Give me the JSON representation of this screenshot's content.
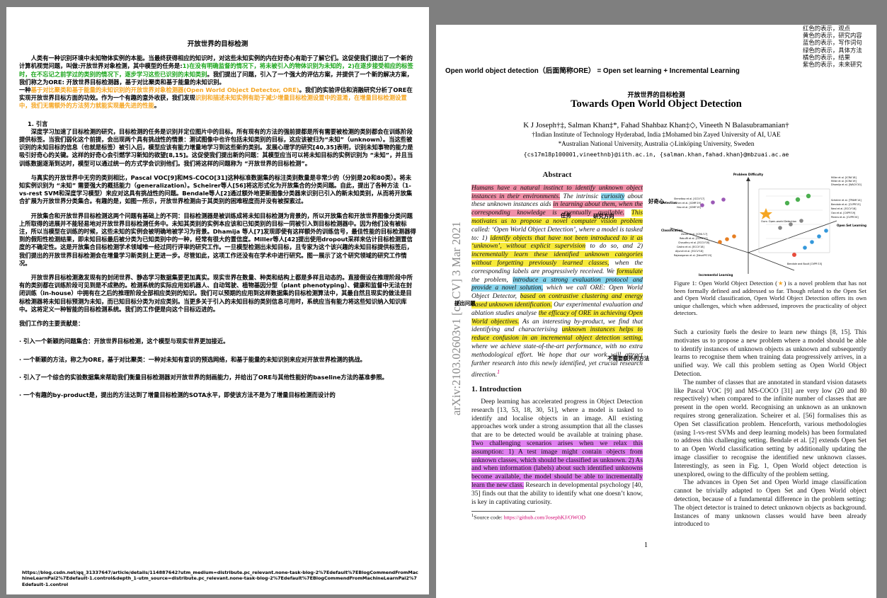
{
  "left_page": {
    "title": "开放世界的目标检测",
    "p1_a": "人类有一种识别环境中未知物体实例的本能。当最终获得相应的知识时，对这些未知实例的内在好奇心有助于了解它们。这促使我们提出了一个新的计算机视觉问题，叫做:开放世界对象检测，其中模型的任务是:",
    "p1_green": "1)在没有明确监督的情况下，将未被引入的物体识别为未知的，2)在逐步接受相应的标签时，在不忘记之前学过的类别的情况下，逐步学习这些已识别的未知类别",
    "p1_b": "。我们提出了问题，引入了一个强大的评估方案，并提供了一个新的解决方案，我们称之为ORE: 开放世界目标检测器，基于对比聚类和基于能量的未知识别。",
    "p1_c": "一种",
    "p1_orange": "基于对比聚类和基于能量的未知识别的开放世界对象检测器(Open World Object Detector, ORE)",
    "p1_d": "。我们的实验评估和消融研究分析了ORE在实现开放世界目标方面的功效。作为一个有趣的意外收获，我们发现",
    "p1_orange2": "识别和描述未知实例有助于减少增量目标检测设置中的混淆，在增量目标检测设置中，我们无需额外的方法努力就能实现最先进的性能",
    "p1_e": "。",
    "sec1": "1. 引言",
    "p2": "深度学习加速了目标检测的研究，目标检测的任务是识别并定位图片中的目标。所有现有的方法的强前提都是所有需要被检测的类别都会在训练阶段提供标签。当我们弱化这个前提，会出现两个具有挑战性的情景：测试图像中也许包括未知类别的目标，这应该被归为“未知”（unknown）。当这些被识别的未知目标的信息（也就是标签）被引入后，模型应该有能力增量地学习到这些新的类别。发展心理学的研究[40,35]表明，识别未知事物的能力是吸引好奇心的关键。这样的好奇心会引燃学习新知的欲望[8,15]。这促使我们提出新的问题：其模型应当可以将未知目标的实例识别为 “未知”，并且当训练数据逐渐到达时，模型可以通过统一的方式学会识别他们。我们将这样的问题称为 “开放世界的目标检测”。",
    "p3": "与真实的开放世界中无穷的类别相比，Pascal VOC[9]和MS-COCO[31]这种标准数据集的标注类别数量是非常少的（分别是20和80类）。将未知实例识别为 “未知” 需要强大的概括能力（generalization）。Scheirer等人[56]将这形式化为开放集合的分类问题。自此，提出了各种方法（1-vs-rest SVM和深度学习模型）来应对这具有挑战性的问题。Bendale等人[2]通过额外地更新图像分类器来识别已引入的新未知类别，从而将开放集合扩展为开放世界分类集合。有趣的是，如图一所示，开放世界检测由于其类别的困难程度而并没有被探索过。",
    "p4": "开放集合和开放世界目标检测这两个问题有基础上的不同：目标检测器是被训练成将未知目标检测为背景的，所以开放集合和开放世界图像分类问题上所取得的进展并不能轻易地对开放世界目标检测任务中。未知其类别的实例本应该和已知类别的目标一同被引入到目标检测器中。因为他们没有被标注，所以当模型在训练的时候，这些未知的实例会被明确地被学习为背景。Dhamija 等人[7]发现即使有这样额外的训练信号，最佳性能的目标检测器得到的假阳性检测结果，即未知目标最后被分类为已知类别中的一种，经常有很大的置信度。Miller等人[42]提出使用dropout采样来估计目标检测置信度的不确定性。这是开放集合目标检测学术领域唯一经过同行评审的研究工作。一旦模型检测出未知目标，且专家为这个该兴趣的未知目标提供标签后，我们提出的开放世界目标检测会在增量学习新类别上更进一步。尽管如此，这项工作还没有在学术中进行研究。图一展示了这个研究领域的研究工作情况。",
    "p5": "开放世界目标检测激发现有的封闭世界、静态学习数据集要更加真实。现实世界在数量、种类和结构上都是多样且动态的。直接假设在推理阶段中所有的类别都在训练阶段可见到是不成熟的。检测系统的实际应用如机器人、自动驾驶、植物基因分型（plant phenotyping）、健康和监督中无法在封闭训练（in-house）中拥有在之后的推理阶段全部相应类别的知识。我们可以预期的应用到这样数据集的目标检测算法中，其最自然且现实的做法是目标检测器将未知目标预测为未知，而已知目标分类为对应类别。当更多关于引入的未知目标的类别信息可用时，系统应当有能力将这些知识纳入知识库中。这将定义一种智能的目标检测系统。我们的工作便是向这个目标迈进的。",
    "contrib_head": "我们工作的主要贡献是：",
    "c1": "· 引入一个新颖的问题集合：开放世界目标检测，这个模型与现实世界更加接近。",
    "c2": "· 一个新颖的方法，称之为ORE，基于对比聚类：一种对未知有意识的预选网络，和基于能量的未知识别来应对开放世界检测的挑战。",
    "c3": "· 引入了一个综合的实验数据集来帮助我们衡量目标检测器对开放世界的刻画能力，并给出了ORE与其他性能好的baseline方法的基准参照。",
    "c4": "· 一个有趣的by-product是，提出的方法达到了增量目标检测的SOTA水平，即使该方法不是为了增量目标检测而设计的",
    "footer": "https://blog.csdn.net/qq_31337647/article/details/114887642?utm_medium=distribute.pc_relevant.none-task-blog-2%7Edefault%7EBlogCommendFromMachineLearnPai2%7Edefault-1.control&depth_1-utm_source=distribute.pc_relevant.none-task-blog-2%7Edefault%7EBlogCommendFromMachineLearnPai2%7Edefault-1.control"
  },
  "legend": [
    "红色的表示，观点",
    "黄色的表示，研究内容",
    "蓝色的表示，写作词句",
    "绿色的表示，具体方法",
    "橘色的表示，结果",
    "紫色的表示，未来研究"
  ],
  "banner": "Open world object detection（后面简称ORE） = Open set learning + Incremental Learning",
  "paper": {
    "cn_title": "开放世界的目标检测",
    "title": "Towards Open World Object Detection",
    "authors": "K J Joseph†‡, Salman Khan‡*, Fahad Shahbaz Khan‡◇, Vineeth N Balasubramanian†",
    "aff1": "†Indian Institute of Technology Hyderabad, India    ‡Mohamed bin Zayed University of AI, UAE",
    "aff2": "*Australian National University, Australia    ◇Linköping University, Sweden",
    "emails": "{cs17m18p100001,vineethnb}@iith.ac.in, {salman.khan,fahad.khan}@mbzuai.ac.ae",
    "arxiv": "arXiv:2103.02603v1  [cs.CV]  3 Mar 2021",
    "abstract_head": "Abstract",
    "abs_1": "Humans have a natural instinct to identify unknown object instances in their environments.",
    "abs_2": " The intrinsic ",
    "abs_3": "curiosity",
    "abs_4": " about these unknown instances aids ",
    "abs_5": "in learning about them, when the corresponding knowledge is eventually available.",
    "abs_6": " ",
    "abs_7": "This motivates us to propose a novel computer vision problem",
    "abs_8": " called: ‘Open World Object Detection’, where a model is tasked to: 1) ",
    "abs_9": "identify objects that have not been introduced to it as ‘unknown’, without explicit supervision",
    "abs_10": " to do so, and 2) ",
    "abs_11": "incrementally learn these identified unknown categories without forgetting previously learned classes,",
    "abs_12": " when the corresponding labels are progressively received. We ",
    "abs_13": "formulate",
    "abs_14": " the problem, ",
    "abs_15": "introduce a strong evaluation protocol and provide a novel solution,",
    "abs_16": " which we call ORE: Open World Object Detector, ",
    "abs_17": "based on contrastive clustering and energy based unknown identification.",
    "abs_18": " Our experimental evaluation and ablation studies analyse ",
    "abs_19": "the efficacy of ORE in achieving Open World objectives.",
    "abs_20": " As an interesting by-product, we find that identifying and characterising ",
    "abs_21": "unknown instances helps to reduce confusion in an incremental object detection setting,",
    "abs_22": " where we achieve state-of-the-art performance, with no extra methodological effort. We hope that our work will attract further research into this newly identified, yet crucial research direction.",
    "abs_sup": "1",
    "intro_head": "1. Introduction",
    "intro_1": "Deep learning has accelerated progress in Object Detection research [13, 53, 18, 30, 51], where a model is tasked to identify and localise objects in an image. All existing approaches work under a strong assumption that all the classes that are to be detected would be available at training phase. ",
    "intro_hl": "Two challenging scenarios arises when we relax this assumption: 1) A test image might contain objects from unknown classes, which should be classified as unknown. 2) As and when information (labels) about such identified unknowns become available, the model should be able to incrementally learn the new class.",
    "intro_2": " Research in developmental psychology [40, 35] finds out that the ability to identify what one doesn’t know, is key in captivating curiosity.",
    "footnote": "Source code: ",
    "footnote_link": "https://github.com/JosephKJ/OWOD",
    "fig_caption_a": "Figure 1: Open World Object Detection (",
    "fig_caption_star": "★",
    "fig_caption_b": ") is a novel problem that has not been formally defined and addressed so far. Though related to the Open Set and Open World classification, Open World Object Detection offers its own unique challenges, which when addressed, improves the practicality of object detectors.",
    "right_p1": "Such a curiosity fuels the desire to learn new things [8, 15]. This motivates us to propose a new problem where a model should be able to identify instances of unknown objects as unknown and subsequently learns to recognise them when training data progressively arrives, in a unified way. We call this problem setting as Open World Object Detection.",
    "right_p2": "The number of classes that are annotated in standard vision datasets like Pascal VOC [9] and MS-COCO [31] are very low (20 and 80 respectively) when compared to the infinite number of classes that are present in the open world. Recognising an unknown as an unknown requires strong generalization. Scheirer et al. [56] formalises this as Open Set classification problem. Henceforth, various methodologies (using 1-vs-rest SVMs and deep learning models) has been formulated to address this challenging setting. Bendale et al. [2] extends Open Set to an Open World classification setting by additionally updating the image classifier to recognise the identified new unknown classes. Interestingly, as seen in Fig. 1, Open World object detection is unexplored, owing to the difficulty of the problem setting.",
    "right_p3": "The advances in Open Set and Open World image classification cannot be trivially adapted to Open Set and Open World object detection, because of a fundamental difference in the problem setting: The object detector is trained to detect unknown objects as background. Instances of many unknown classes would have been already introduced to",
    "page_num": "1"
  },
  "notes": {
    "curiosity": "好奇心",
    "task": "任务",
    "direction": "研究方向",
    "formulate": "提出问题",
    "method": "不需要额外的方法"
  },
  "figure": {
    "axis_problem": "Problem Difficulty",
    "axis_detection": "Detection",
    "axis_classification": "Classification",
    "axis_incremental": "Incremental Learning",
    "axis_open": "Open Set Learning",
    "ore_label": "Ours: Open-world Detection",
    "det_refs": [
      "Miller et al. [ICRA'18]",
      "Miller et al. [ICRA'19]",
      "Dhamija et al. [WACV'20]"
    ],
    "left_refs": [
      "Shmelkov et al. [ICCV'17]",
      "Chen et al. [ICMR'19]",
      "Hao et al. [ICME'19]"
    ],
    "right_refs": [
      "Scheirer et al. [TPAMI'14]",
      "Bendale et al. [CVPR'15]",
      "Neal et al. [ECCV'18]",
      "Oza et al. [CVPR'19]",
      "Perera et al. [CVPR'20]"
    ],
    "cls_refs": [
      "Zenke et al. [ICML'17]",
      "Rebuffi et al. [CVPR'17]",
      "Chaudhry et al. [ECCV'18]",
      "Castro et al. [ECCV'18]",
      "Aljundi et al. [ECCV'18]",
      "Rajasegaran et al. [NeurIPS'19]"
    ],
    "bendale": "Bendale and Boult [CVPR'15]"
  }
}
